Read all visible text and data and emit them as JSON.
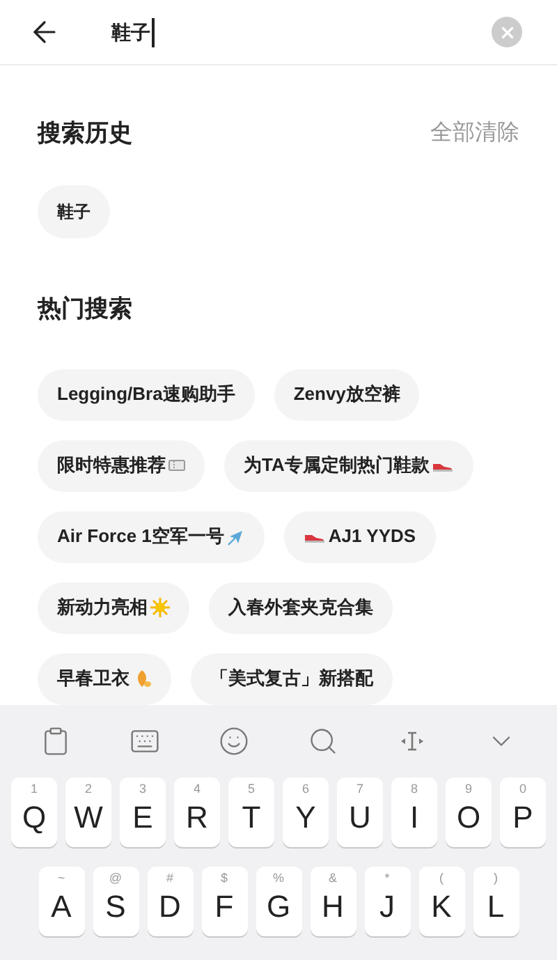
{
  "search": {
    "value": "鞋子"
  },
  "history": {
    "title": "搜索历史",
    "clear_label": "全部清除",
    "items": [
      "鞋子"
    ]
  },
  "hot": {
    "title": "热门搜索",
    "items": [
      {
        "label": "Legging/Bra速购助手",
        "kind": "plain"
      },
      {
        "label": "Zenvy放空裤",
        "kind": "plain"
      },
      {
        "label": "限时特惠推荐",
        "kind": "trailing"
      },
      {
        "label": "为TA专属定制热门鞋款",
        "kind": "trailing"
      },
      {
        "label": "Air Force 1空军一号",
        "kind": "trailing"
      },
      {
        "label": "AJ1 YYDS",
        "kind": "leading"
      },
      {
        "label": "新动力亮相",
        "kind": "trailing"
      },
      {
        "label": "入春外套夹克合集",
        "kind": "plain"
      },
      {
        "label": "早春卫衣",
        "kind": "trailing"
      },
      {
        "label": "「美式复古」新搭配",
        "kind": "plain"
      }
    ]
  },
  "keyboard": {
    "rows": [
      [
        {
          "main": "Q",
          "sub": "1"
        },
        {
          "main": "W",
          "sub": "2"
        },
        {
          "main": "E",
          "sub": "3"
        },
        {
          "main": "R",
          "sub": "4"
        },
        {
          "main": "T",
          "sub": "5"
        },
        {
          "main": "Y",
          "sub": "6"
        },
        {
          "main": "U",
          "sub": "7"
        },
        {
          "main": "I",
          "sub": "8"
        },
        {
          "main": "O",
          "sub": "9"
        },
        {
          "main": "P",
          "sub": "0"
        }
      ],
      [
        {
          "main": "A",
          "sub": "~"
        },
        {
          "main": "S",
          "sub": "@"
        },
        {
          "main": "D",
          "sub": "#"
        },
        {
          "main": "F",
          "sub": "$"
        },
        {
          "main": "G",
          "sub": "%"
        },
        {
          "main": "H",
          "sub": "&"
        },
        {
          "main": "J",
          "sub": "*"
        },
        {
          "main": "K",
          "sub": "("
        },
        {
          "main": "L",
          "sub": ")"
        }
      ]
    ]
  }
}
